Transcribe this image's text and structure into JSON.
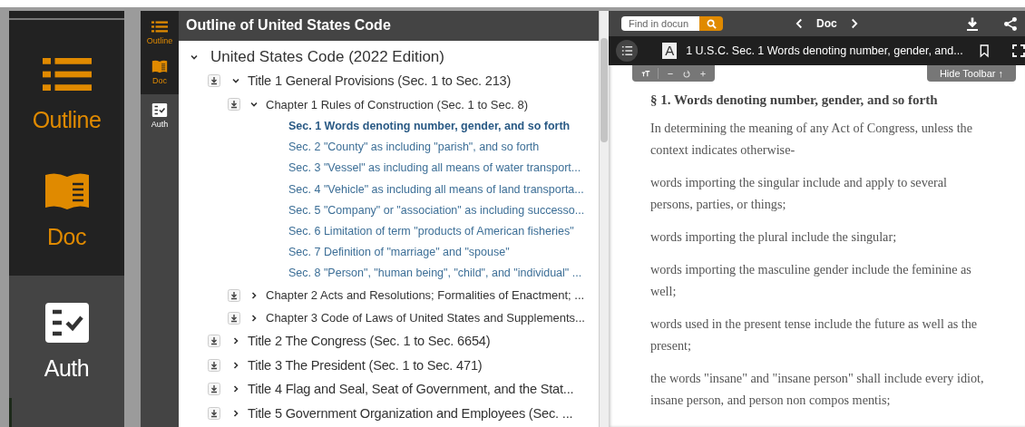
{
  "zoom_nav": {
    "items": [
      {
        "kind": "outline",
        "label": "Outline",
        "active": true
      },
      {
        "kind": "doc",
        "label": "Doc",
        "active": true
      },
      {
        "kind": "auth",
        "label": "Auth",
        "active": false
      }
    ]
  },
  "side_nav": {
    "items": [
      {
        "kind": "outline",
        "label": "Outline",
        "active": true
      },
      {
        "kind": "doc",
        "label": "Doc",
        "active": true
      },
      {
        "kind": "auth",
        "label": "Auth",
        "active": false
      }
    ]
  },
  "outline": {
    "title": "Outline of United States Code",
    "tree": [
      {
        "kind": "root",
        "label": "United States Code (2022 Edition)",
        "expanded": true,
        "children": [
          {
            "kind": "title",
            "label": "Title 1 General Provisions (Sec. 1 to Sec. 213)",
            "expanded": true,
            "children": [
              {
                "kind": "chapter",
                "label": "Chapter 1 Rules of Construction (Sec. 1 to Sec. 8)",
                "expanded": true,
                "children": [
                  {
                    "kind": "section",
                    "label": "Sec. 1 Words denoting number, gender, and so forth",
                    "selected": true
                  },
                  {
                    "kind": "section",
                    "label": "Sec. 2 \"County\" as including \"parish\", and so forth",
                    "selected": false
                  },
                  {
                    "kind": "section",
                    "label": "Sec. 3 \"Vessel\" as including all means of water transport...",
                    "selected": false
                  },
                  {
                    "kind": "section",
                    "label": "Sec. 4 \"Vehicle\" as including all means of land transporta...",
                    "selected": false
                  },
                  {
                    "kind": "section",
                    "label": "Sec. 5 \"Company\" or \"association\" as including successo...",
                    "selected": false
                  },
                  {
                    "kind": "section",
                    "label": "Sec. 6 Limitation of term \"products of American fisheries\"",
                    "selected": false
                  },
                  {
                    "kind": "section",
                    "label": "Sec. 7 Definition of \"marriage\" and \"spouse\"",
                    "selected": false
                  },
                  {
                    "kind": "section",
                    "label": "Sec. 8 \"Person\", \"human being\", \"child\", and \"individual\" ...",
                    "selected": false
                  }
                ]
              },
              {
                "kind": "chapter",
                "label": "Chapter 2 Acts and Resolutions; Formalities of Enactment; ...",
                "expanded": false
              },
              {
                "kind": "chapter",
                "label": "Chapter 3 Code of Laws of United States and Supplements...",
                "expanded": false
              }
            ]
          },
          {
            "kind": "title",
            "label": "Title 2 The Congress (Sec. 1 to Sec. 6654)",
            "expanded": false
          },
          {
            "kind": "title",
            "label": "Title 3 The President (Sec. 1 to Sec. 471)",
            "expanded": false
          },
          {
            "kind": "title",
            "label": "Title 4 Flag and Seal, Seat of Government, and the Stat...",
            "expanded": false
          },
          {
            "kind": "title",
            "label": "Title 5 Government Organization and Employees (Sec. ...",
            "expanded": false
          }
        ]
      }
    ]
  },
  "doc": {
    "search": {
      "value": "Find in docun"
    },
    "nav_label": "Doc",
    "font_letter": "A",
    "doc_title": "1 U.S.C. Sec. 1 Words denoting number, gender, and...",
    "hide_toolbar": "Hide Toolbar ↑",
    "heading": "§ 1. Words denoting number, gender, and so forth",
    "paragraphs": [
      "In determining the meaning of any Act of Congress, unless the context indicates otherwise-",
      "words importing the singular include and apply to several persons, parties, or things;",
      "words importing the plural include the singular;",
      "words importing the masculine gender include the feminine as well;",
      "words used in the present tense include the future as well as the present;",
      "the words \"insane\" and \"insane person\" shall include every idiot, insane person, and person non compos mentis;"
    ]
  }
}
